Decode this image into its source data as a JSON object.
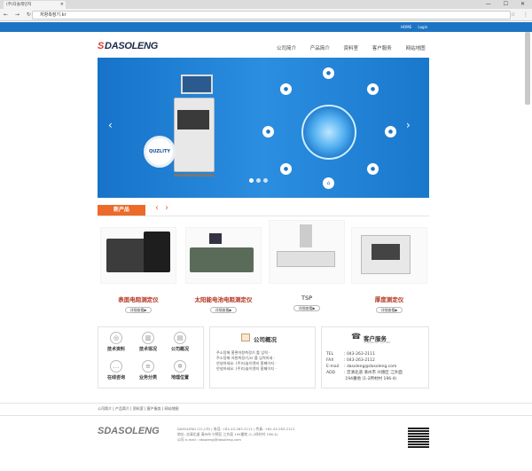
{
  "browser": {
    "tab_title": "(주)다솔레인지",
    "tab_close": "×",
    "window_controls": "— ☐ ✕",
    "nav_buttons": "← → ↻ ⌂",
    "url": "저항측정기.kr",
    "star": "☆",
    "menu": "⋮"
  },
  "topbar": {
    "links": [
      "HOME",
      "Login"
    ]
  },
  "header": {
    "logo_mark": "S",
    "logo_text": "DASOLENG",
    "nav": [
      "公司简介",
      "产品简介",
      "资料室",
      "客户服务",
      "网站地图"
    ]
  },
  "banner": {
    "badge": "QUZLITY",
    "prev": "‹",
    "next": "›",
    "dots": 3,
    "active_dot": 0
  },
  "new_products": {
    "label": "新产品",
    "arrows": "‹ ›",
    "items": [
      {
        "name": "表面电阻测定仪",
        "button": "详细查看▶"
      },
      {
        "name": "太阳能电池电阻测定仪",
        "button": "详细查看▶"
      },
      {
        "name": "TSP",
        "button": "详细查看▶"
      },
      {
        "name": "厚度测定仪",
        "button": "详细查看▶"
      }
    ]
  },
  "quick_links": [
    {
      "label": "技术资料",
      "icon": "globe-icon"
    },
    {
      "label": "技术现况",
      "icon": "chart-icon"
    },
    {
      "label": "公司概况",
      "icon": "document-icon"
    },
    {
      "label": "在线咨询",
      "icon": "chat-icon"
    },
    {
      "label": "业务分类",
      "icon": "list-icon"
    },
    {
      "label": "地理位置",
      "icon": "gear-icon"
    }
  ],
  "company_news": {
    "title": "公司概况",
    "items": [
      "주소탕해 홈편저항측정기 를 입력 · ",
      "주소탕해 저항측정기,kr 를 입력하세 · ",
      "안녕하세요. (주)다솔이엔지 홈페이지 · ",
      "안녕하세요. (주)다솔이엔지 홈페이지 · "
    ]
  },
  "contact": {
    "title": "客户服务",
    "subtitle": "Customer Center",
    "rows": [
      {
        "k": "TEL",
        "v": ": 043-263-2111"
      },
      {
        "k": "FAX",
        "v": ": 043-263-2112"
      },
      {
        "k": "E-mail",
        "v": ": dasoleng@dasoleng.com"
      },
      {
        "k": "ADD",
        "v": ": 忠清北道 清州市 兴德区 江外面"
      },
      {
        "k": "",
        "v": "  194番地 (1-2所村村 196-4)"
      }
    ]
  },
  "footer": {
    "links": "公司简介 | 产品简介 | 资料室 | 客户服务 | 网站地图",
    "logo_mark": "S",
    "logo_text": "DASOLENG",
    "info": [
      "DASOLENG CO.,LTD | 电话: +82-43-263-2111 | 传真: +82-43-263-2112",
      "地址: 忠清北道 清州市 兴德区 江外面 194番地 (1-2所村村 196-4)",
      "公司 e-mail : dasoleng@dasoleng.com"
    ]
  }
}
